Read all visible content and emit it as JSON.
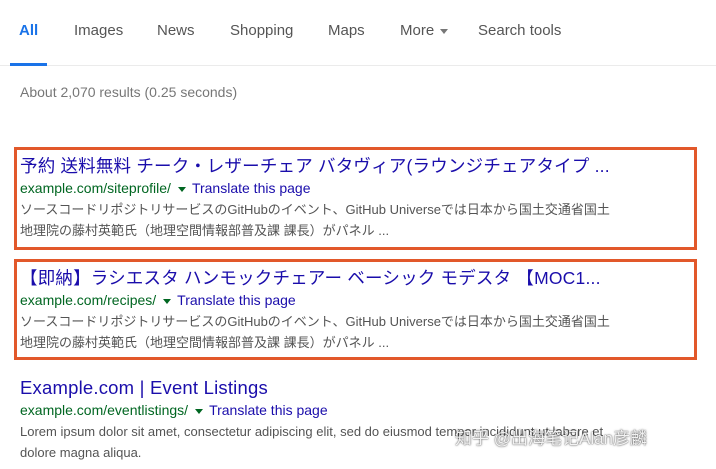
{
  "tabs": [
    {
      "label": "All"
    },
    {
      "label": "Images"
    },
    {
      "label": "News"
    },
    {
      "label": "Shopping"
    },
    {
      "label": "Maps"
    },
    {
      "label": "More"
    },
    {
      "label": "Search tools"
    }
  ],
  "stats": "About 2,070 results (0.25 seconds)",
  "results": [
    {
      "title": "予約 送料無料 チーク・レザーチェア バタヴィア(ラウンジチェアタイプ ...",
      "url": "example.com/siteprofile/",
      "translate": "Translate this page",
      "snippet_line1": "ソースコードリポジトリサービスのGitHubのイベント、GitHub Universeでは日本から国土交通省国土",
      "snippet_line2": "地理院の藤村英範氏（地理空間情報部普及課 課長）がパネル ..."
    },
    {
      "title": "【即納】ラシエスタ ハンモックチェアー ベーシック モデスタ 【MOC1...",
      "url": "example.com/recipes/",
      "translate": "Translate this page",
      "snippet_line1": "ソースコードリポジトリサービスのGitHubのイベント、GitHub Universeでは日本から国土交通省国土",
      "snippet_line2": "地理院の藤村英範氏（地理空間情報部普及課 課長）がパネル ..."
    },
    {
      "title": "Example.com | Event Listings",
      "url": "example.com/eventlistings/",
      "translate": "Translate this page",
      "snippet_line1": "Lorem ipsum dolor sit amet, consectetur adipiscing elit, sed do eiusmod tempor incididunt ut labore et",
      "snippet_line2": "dolore magna aliqua."
    }
  ],
  "watermark": "知乎 @出海笔记Alan彦麟",
  "colors": {
    "active_tab": "#1a73e8",
    "title_link": "#1a0dab",
    "url_green": "#006621",
    "snippet": "#545454",
    "highlight_box": "#e2582a"
  }
}
